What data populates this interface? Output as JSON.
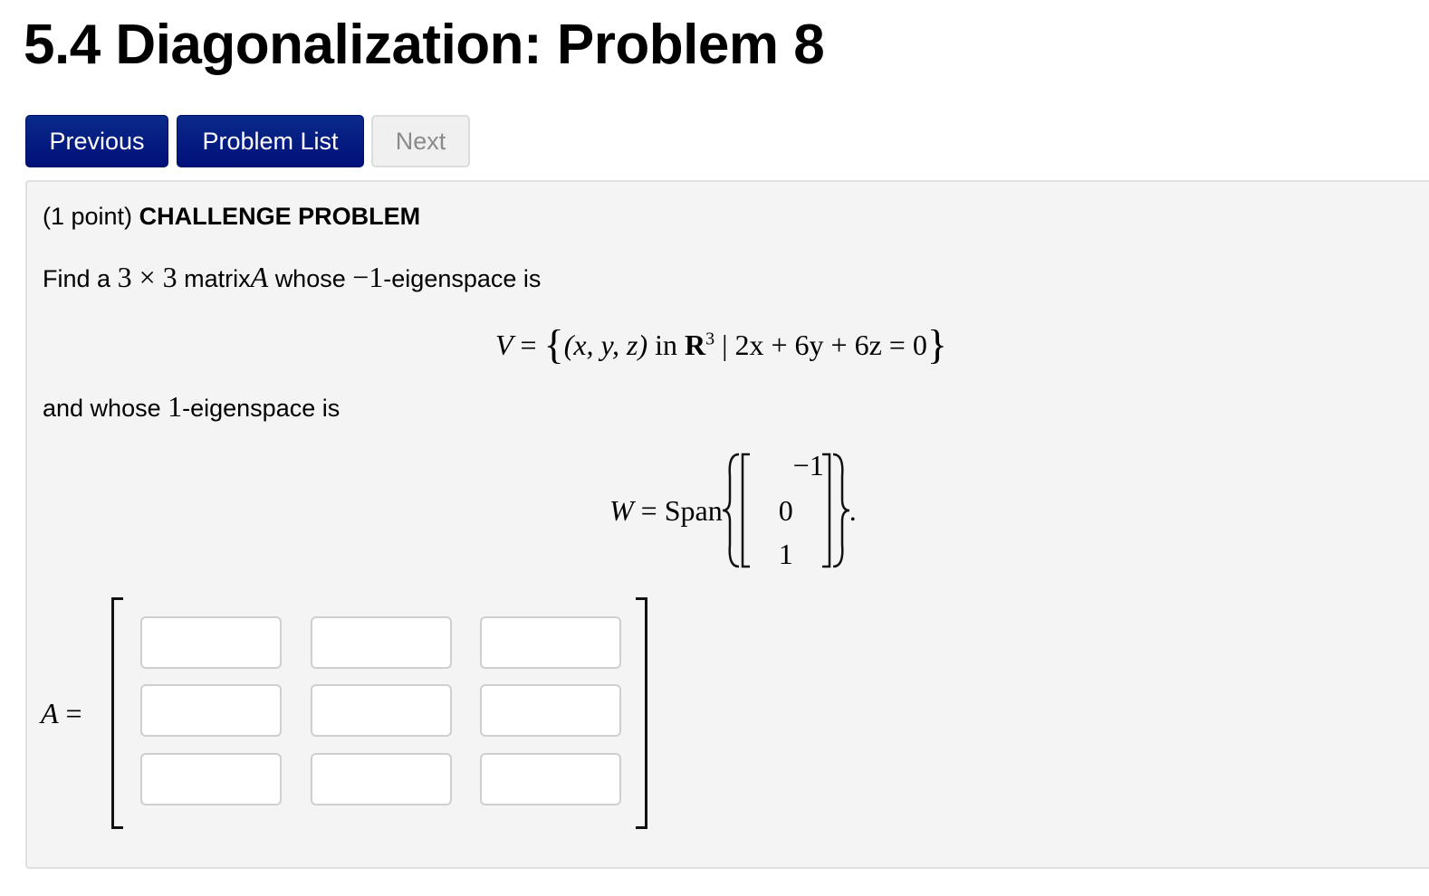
{
  "page": {
    "title": "5.4 Diagonalization: Problem 8"
  },
  "nav": {
    "previous_label": "Previous",
    "problem_list_label": "Problem List",
    "next_label": "Next"
  },
  "problem": {
    "points": "(1 point)",
    "heading": "CHALLENGE PROBLEM",
    "intro": {
      "find_a": "Find a",
      "size": "3 × 3",
      "matrix_word": "matrix",
      "matrix_var": "A",
      "whose": "whose",
      "eigen_neg": "−1",
      "eigenspace_is": "-eigenspace is"
    },
    "v_set": {
      "lhs": "V",
      "equals": "=",
      "open": "{",
      "tuple": "(x, y, z)",
      "in": "in",
      "space": "R",
      "space_exp": "3",
      "bar": "|",
      "condition": "2x + 6y + 6z = 0",
      "close": "}"
    },
    "and_whose": {
      "prefix": "and whose",
      "eigen_pos": "1",
      "suffix": "-eigenspace is"
    },
    "w_span": {
      "lhs": "W",
      "equals": "=",
      "span": "Span",
      "vector": [
        "−1",
        "0",
        "1"
      ],
      "period": "."
    },
    "answer": {
      "label_var": "A",
      "label_eq": "=",
      "cells": [
        [
          "",
          "",
          ""
        ],
        [
          "",
          "",
          ""
        ],
        [
          "",
          "",
          ""
        ]
      ]
    }
  }
}
